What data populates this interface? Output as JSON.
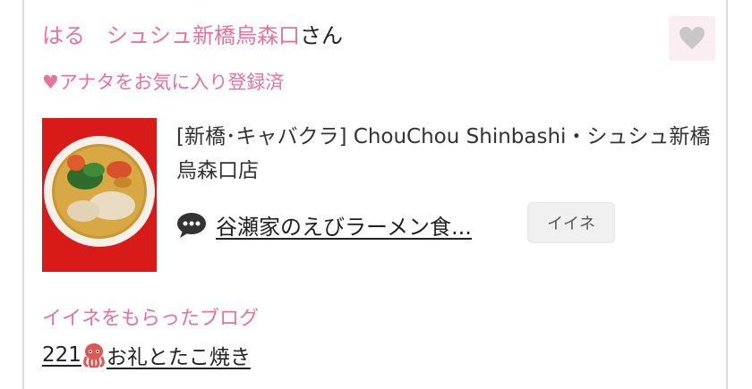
{
  "header": {
    "name": "はる",
    "shop_name": "シュシュ新橋烏森口",
    "honorific": "さん"
  },
  "favorite": {
    "status_label": "♥アナタをお気に入り登録済",
    "button_icon": "heart-icon"
  },
  "shop": {
    "description": "[新橋･キャバクラ]  ChouChou Shinbashi・シュシュ新橋烏森口店"
  },
  "comment": {
    "icon": "speech-bubble-icon",
    "link_text": "谷瀬家のえびラーメン食..."
  },
  "iine_button": {
    "label": "イイネ"
  },
  "liked_blog": {
    "section_title": "イイネをもらったブログ",
    "count_text": "221",
    "emoji_icon": "octopus-icon",
    "title_text": "お礼とたこ焼き"
  },
  "colors": {
    "accent_pink": "#e8739a",
    "heart_gray": "#c8c8c8",
    "fav_button_bg": "#fbeef2",
    "thumb_bg": "#d81b18"
  }
}
